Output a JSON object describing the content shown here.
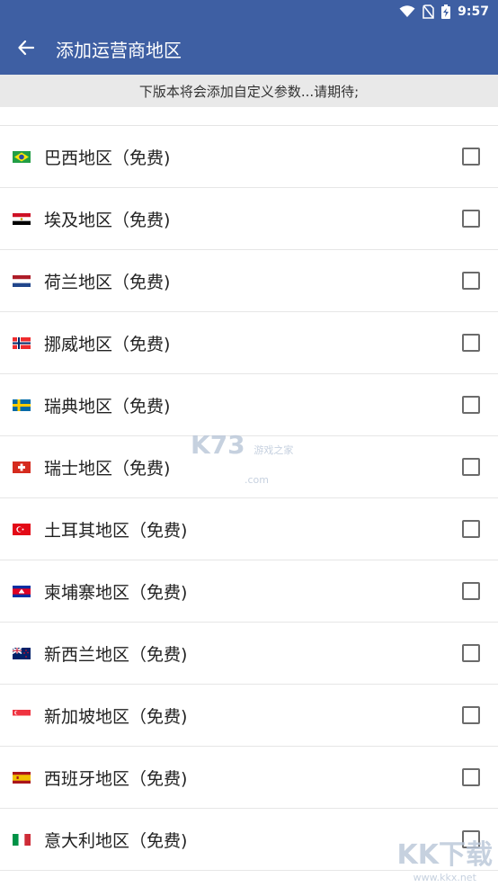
{
  "status_bar": {
    "time": "9:57",
    "icons": [
      "wifi-icon",
      "no-sim-icon",
      "battery-charging-icon"
    ]
  },
  "app_bar": {
    "back_icon": "arrow-left-icon",
    "title": "添加运营商地区"
  },
  "notice": "下版本将会添加自定义参数...请期待;",
  "regions": [
    {
      "label": "巴西地区（免费)",
      "flag": "brazil"
    },
    {
      "label": "埃及地区（免费)",
      "flag": "egypt"
    },
    {
      "label": "荷兰地区（免费)",
      "flag": "netherlands"
    },
    {
      "label": "挪威地区（免费)",
      "flag": "norway"
    },
    {
      "label": "瑞典地区（免费)",
      "flag": "sweden"
    },
    {
      "label": "瑞士地区（免费)",
      "flag": "switzerland"
    },
    {
      "label": "土耳其地区（免费)",
      "flag": "turkey"
    },
    {
      "label": "柬埔寨地区（免费)",
      "flag": "cambodia"
    },
    {
      "label": "新西兰地区（免费)",
      "flag": "new-zealand"
    },
    {
      "label": "新加坡地区（免费)",
      "flag": "singapore"
    },
    {
      "label": "西班牙地区（免费)",
      "flag": "spain"
    },
    {
      "label": "意大利地区（免费)",
      "flag": "italy"
    }
  ],
  "watermarks": {
    "center_main": "K73",
    "center_sub": "游戏之家",
    "center_domain": ".com",
    "corner_main": "KK下载",
    "corner_domain": "www.kkx.net"
  },
  "colors": {
    "primary": "#3e5fa3",
    "notice_bg": "#e9e9e9"
  }
}
